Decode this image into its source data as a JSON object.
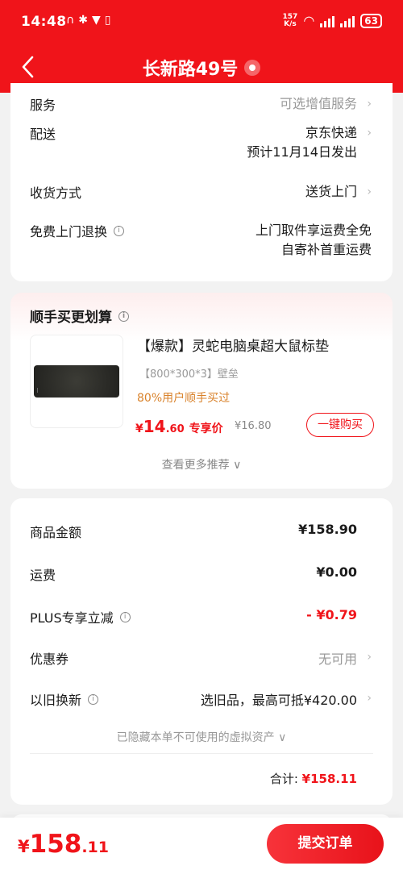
{
  "status_bar": {
    "time": "14:48",
    "net_speed_top": "157",
    "net_speed_bottom": "K/s",
    "battery": "63"
  },
  "header": {
    "title": "长新路49号"
  },
  "delivery": {
    "service_label": "服务",
    "service_value": "可选增值服务",
    "shipping_label": "配送",
    "shipping_value": "京东快递",
    "shipping_eta": "预计11月14日发出",
    "receive_label": "收货方式",
    "receive_value": "送货上门",
    "return_label": "免费上门退换",
    "return_line1": "上门取件享运费全免",
    "return_line2": "自寄补首重运费"
  },
  "addon": {
    "title": "顺手买更划算",
    "product_name": "【爆款】灵蛇电脑桌超大鼠标垫",
    "spec": "【800*300*3】壁垒",
    "note": "80%用户顺手买过",
    "price_currency": "¥",
    "price_int": "14",
    "price_dec": ".60",
    "price_label": "专享价",
    "original_price": "¥16.80",
    "buy_button": "一键购买",
    "more": "查看更多推荐"
  },
  "summary": {
    "goods_label": "商品金额",
    "goods_value": "¥158.90",
    "freight_label": "运费",
    "freight_value": "¥0.00",
    "plus_label": "PLUS专享立减",
    "plus_value": "- ¥0.79",
    "coupon_label": "优惠券",
    "coupon_value": "无可用",
    "tradein_label": "以旧换新",
    "tradein_value": "选旧品，最高可抵¥420.00",
    "hidden_assets": "已隐藏本单不可使用的虚拟资产",
    "total_label": "合计:",
    "total_value": "¥158.11"
  },
  "footer": {
    "price_currency": "¥",
    "price_int": "158",
    "price_dec": ".11",
    "submit_label": "提交订单"
  },
  "colors": {
    "brand_red": "#f0141a",
    "note_orange": "#d9822b",
    "background": "#f2f2f2"
  }
}
